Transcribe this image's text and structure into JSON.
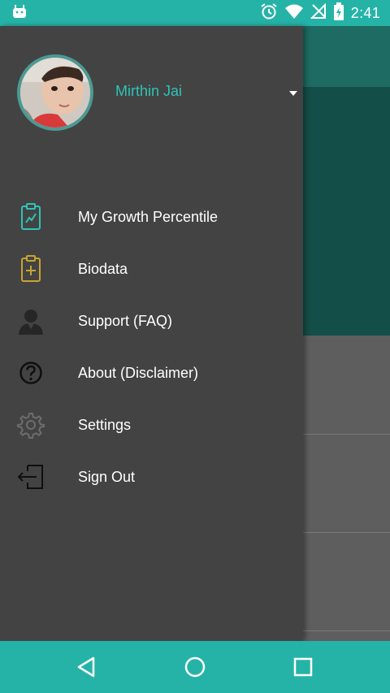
{
  "status_bar": {
    "time": "2:41",
    "icons": [
      "android-debug-icon",
      "alarm-icon",
      "wifi-icon",
      "no-signal-icon",
      "battery-charging-icon"
    ]
  },
  "drawer": {
    "user_name": "Mirthin Jai",
    "menu": [
      {
        "label": "My Growth Percentile",
        "icon": "growth-clipboard-icon"
      },
      {
        "label": "Biodata",
        "icon": "medical-clipboard-icon"
      },
      {
        "label": "Support (FAQ)",
        "icon": "user-support-icon"
      },
      {
        "label": "About (Disclaimer)",
        "icon": "question-circle-icon"
      },
      {
        "label": "Settings",
        "icon": "gear-icon"
      },
      {
        "label": "Sign Out",
        "icon": "sign-out-icon"
      }
    ]
  },
  "nav_bar": {
    "buttons": [
      "back-icon",
      "home-icon",
      "recents-icon"
    ]
  },
  "colors": {
    "status_bar": "#26b3a7",
    "drawer_bg": "#434343",
    "accent": "#2ec4b6",
    "bg_toolbar": "#1d6b62",
    "bg_hero": "#134e48"
  }
}
